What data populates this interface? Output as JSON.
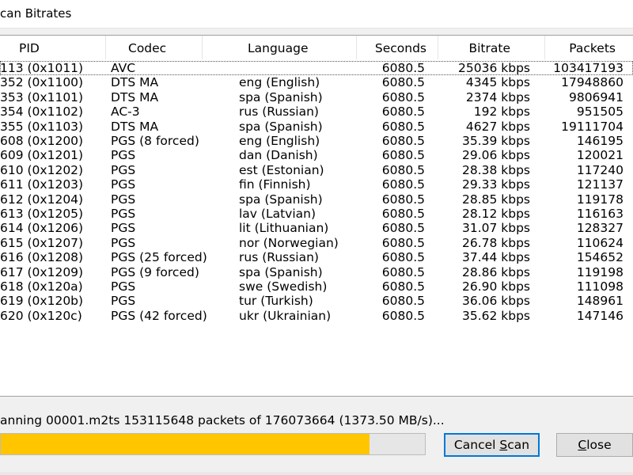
{
  "window": {
    "title": "can Bitrates"
  },
  "columns": {
    "pid": "PID",
    "codec": "Codec",
    "language": "Language",
    "seconds": "Seconds",
    "bitrate": "Bitrate",
    "packets": "Packets"
  },
  "rows": [
    {
      "pid": "113 (0x1011)",
      "codec": "AVC",
      "language": "",
      "seconds": "6080.5",
      "bitrate": "25036 kbps",
      "packets": "103417193"
    },
    {
      "pid": "352 (0x1100)",
      "codec": "DTS MA",
      "language": "eng (English)",
      "seconds": "6080.5",
      "bitrate": "4345 kbps",
      "packets": "17948860"
    },
    {
      "pid": "353 (0x1101)",
      "codec": "DTS MA",
      "language": "spa (Spanish)",
      "seconds": "6080.5",
      "bitrate": "2374 kbps",
      "packets": "9806941"
    },
    {
      "pid": "354 (0x1102)",
      "codec": "AC-3",
      "language": "rus (Russian)",
      "seconds": "6080.5",
      "bitrate": "192 kbps",
      "packets": "951505"
    },
    {
      "pid": "355 (0x1103)",
      "codec": "DTS MA",
      "language": "spa (Spanish)",
      "seconds": "6080.5",
      "bitrate": "4627 kbps",
      "packets": "19111704"
    },
    {
      "pid": "608 (0x1200)",
      "codec": "PGS (8 forced)",
      "language": "eng (English)",
      "seconds": "6080.5",
      "bitrate": "35.39 kbps",
      "packets": "146195"
    },
    {
      "pid": "609 (0x1201)",
      "codec": "PGS",
      "language": "dan (Danish)",
      "seconds": "6080.5",
      "bitrate": "29.06 kbps",
      "packets": "120021"
    },
    {
      "pid": "610 (0x1202)",
      "codec": "PGS",
      "language": "est (Estonian)",
      "seconds": "6080.5",
      "bitrate": "28.38 kbps",
      "packets": "117240"
    },
    {
      "pid": "611 (0x1203)",
      "codec": "PGS",
      "language": "fin (Finnish)",
      "seconds": "6080.5",
      "bitrate": "29.33 kbps",
      "packets": "121137"
    },
    {
      "pid": "612 (0x1204)",
      "codec": "PGS",
      "language": "spa (Spanish)",
      "seconds": "6080.5",
      "bitrate": "28.85 kbps",
      "packets": "119178"
    },
    {
      "pid": "613 (0x1205)",
      "codec": "PGS",
      "language": "lav (Latvian)",
      "seconds": "6080.5",
      "bitrate": "28.12 kbps",
      "packets": "116163"
    },
    {
      "pid": "614 (0x1206)",
      "codec": "PGS",
      "language": "lit (Lithuanian)",
      "seconds": "6080.5",
      "bitrate": "31.07 kbps",
      "packets": "128327"
    },
    {
      "pid": "615 (0x1207)",
      "codec": "PGS",
      "language": "nor (Norwegian)",
      "seconds": "6080.5",
      "bitrate": "26.78 kbps",
      "packets": "110624"
    },
    {
      "pid": "616 (0x1208)",
      "codec": "PGS (25 forced)",
      "language": "rus (Russian)",
      "seconds": "6080.5",
      "bitrate": "37.44 kbps",
      "packets": "154652"
    },
    {
      "pid": "617 (0x1209)",
      "codec": "PGS (9 forced)",
      "language": "spa (Spanish)",
      "seconds": "6080.5",
      "bitrate": "28.86 kbps",
      "packets": "119198"
    },
    {
      "pid": "618 (0x120a)",
      "codec": "PGS",
      "language": "swe (Swedish)",
      "seconds": "6080.5",
      "bitrate": "26.90 kbps",
      "packets": "111098"
    },
    {
      "pid": "619 (0x120b)",
      "codec": "PGS",
      "language": "tur (Turkish)",
      "seconds": "6080.5",
      "bitrate": "36.06 kbps",
      "packets": "148961"
    },
    {
      "pid": "620 (0x120c)",
      "codec": "PGS (42 forced)",
      "language": "ukr (Ukrainian)",
      "seconds": "6080.5",
      "bitrate": "35.62 kbps",
      "packets": "147146"
    }
  ],
  "status": {
    "text": "anning 00001.m2ts 153115648 packets of 176073664 (1373.50 MB/s)..."
  },
  "progress": {
    "fraction": 0.87,
    "color": "#ffc600"
  },
  "buttons": {
    "cancel_pre": "Cancel ",
    "cancel_key": "S",
    "cancel_post": "can",
    "close_key": "C",
    "close_post": "lose"
  },
  "colors": {
    "default_button_border": "#0078d7"
  }
}
